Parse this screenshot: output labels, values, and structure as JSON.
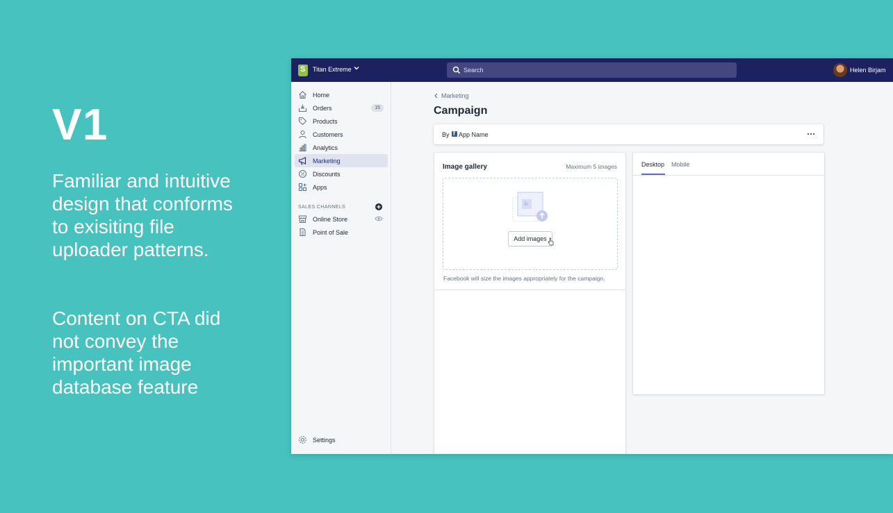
{
  "slide": {
    "heading": "V1",
    "paragraph1": "Familiar and intuitive design that conforms to exisiting file uploader patterns.",
    "paragraph2": "Content on CTA did not convey the important image database feature",
    "background_color": "#48c2bf"
  },
  "topbar": {
    "store_name": "Titan Extreme",
    "search_placeholder": "Search",
    "user_name": "Helen Birjam",
    "background_color": "#1c2260"
  },
  "sidebar": {
    "items": [
      {
        "label": "Home",
        "icon": "home-icon"
      },
      {
        "label": "Orders",
        "icon": "orders-icon",
        "badge": "15"
      },
      {
        "label": "Products",
        "icon": "tag-icon"
      },
      {
        "label": "Customers",
        "icon": "person-icon"
      },
      {
        "label": "Analytics",
        "icon": "bar-chart-icon"
      },
      {
        "label": "Marketing",
        "icon": "megaphone-icon",
        "active": true
      },
      {
        "label": "Discounts",
        "icon": "discount-icon"
      },
      {
        "label": "Apps",
        "icon": "apps-icon"
      }
    ],
    "channels_heading": "SALES CHANNELS",
    "channels": [
      {
        "label": "Online Store",
        "icon": "store-icon"
      },
      {
        "label": "Point of Sale",
        "icon": "pos-icon"
      }
    ],
    "settings_label": "Settings"
  },
  "main": {
    "breadcrumb": "Marketing",
    "page_title": "Campaign",
    "by_label": "By",
    "app_name": "App Name",
    "gallery": {
      "title": "Image gallery",
      "max_label": "Maximum 5 images",
      "add_button": "Add images",
      "helper_text": "Facebook will size the images appropriately for the campaign."
    },
    "preview": {
      "tabs": [
        "Desktop",
        "Mobile"
      ],
      "active_tab": "Desktop"
    }
  }
}
